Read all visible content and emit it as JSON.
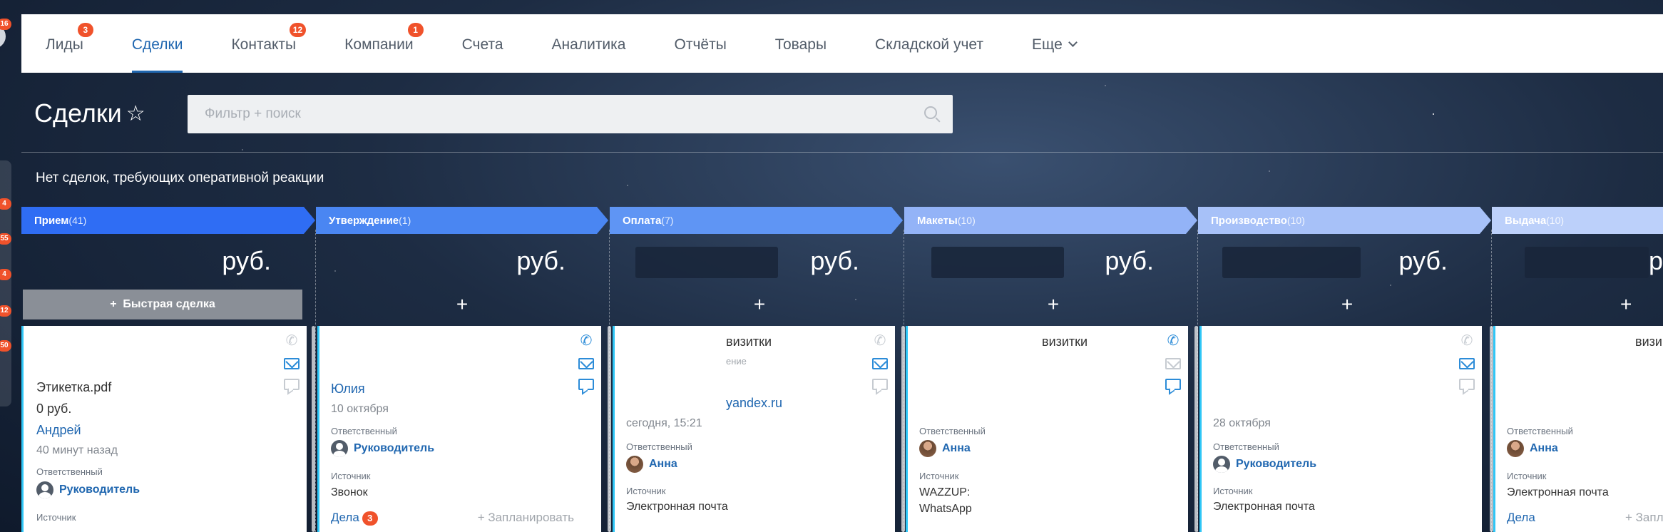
{
  "rail": {
    "badges": [
      "16",
      "4",
      "55",
      "4",
      "12",
      "50"
    ]
  },
  "nav": {
    "items": [
      {
        "label": "Лиды",
        "badge": "3"
      },
      {
        "label": "Сделки",
        "badge": ""
      },
      {
        "label": "Контакты",
        "badge": "12"
      },
      {
        "label": "Компании",
        "badge": "1"
      },
      {
        "label": "Счета",
        "badge": ""
      },
      {
        "label": "Аналитика",
        "badge": ""
      },
      {
        "label": "Отчёты",
        "badge": ""
      },
      {
        "label": "Товары",
        "badge": ""
      },
      {
        "label": "Складской учет",
        "badge": ""
      },
      {
        "label": "Еще",
        "badge": ""
      }
    ],
    "active": "Сделки"
  },
  "page": {
    "title": "Сделки",
    "search_placeholder": "Фильтр + поиск",
    "notice": "Нет сделок, требующих оперативной реакции"
  },
  "colors": {
    "accent": "#2067b0",
    "badge": "#f0522b"
  },
  "columns": [
    {
      "name": "Прием",
      "count": "(41)",
      "color": "#2f6df4",
      "sum": "руб.",
      "action": "Быстрая сделка",
      "card": {
        "title": "Этикетка.pdf",
        "amount": "0 руб.",
        "contact": "Андрей",
        "time": "40 минут назад",
        "resp_label": "Ответственный",
        "resp": "Руководитель",
        "source_label": "Источник"
      }
    },
    {
      "name": "Утверждение",
      "count": "(1)",
      "color": "#4a86f2",
      "sum": "руб.",
      "action": "+",
      "card": {
        "contact": "Юлия",
        "date": "10 октября",
        "resp_label": "Ответственный",
        "resp": "Руководитель",
        "source_label": "Источник",
        "source": "Звонок",
        "deals": "Дела",
        "deals_count": "3",
        "plan": "+ Запланировать"
      }
    },
    {
      "name": "Оплата",
      "count": "(7)",
      "color": "#5f95f4",
      "sum": "руб.",
      "action": "+",
      "card": {
        "title": "визитки",
        "sub": "ение",
        "email": "yandex.ru",
        "time": "сегодня, 15:21",
        "resp_label": "Ответственный",
        "resp": "Анна",
        "source_label": "Источник",
        "source": "Электронная почта"
      }
    },
    {
      "name": "Макеты",
      "count": "(10)",
      "color": "#93b3f7",
      "sum": "руб.",
      "action": "+",
      "card": {
        "title": "визитки",
        "resp_label": "Ответственный",
        "resp": "Анна",
        "source_label": "Источник",
        "source": "WAZZUP:",
        "source2": "WhatsApp"
      }
    },
    {
      "name": "Производство",
      "count": "(10)",
      "color": "#a7c1f8",
      "sum": "руб.",
      "action": "+",
      "card": {
        "date": "28 октября",
        "resp_label": "Ответственный",
        "resp": "Руководитель",
        "source_label": "Источник",
        "source": "Электронная почта"
      }
    },
    {
      "name": "Выдача",
      "count": "(10)",
      "color": "#bcd0fa",
      "sum": "р",
      "action": "+",
      "card": {
        "title": "визи",
        "resp_label": "Ответственный",
        "resp": "Анна",
        "source_label": "Источник",
        "source": "Электронная почта",
        "deals": "Дела",
        "plan": "+ Запла"
      }
    }
  ]
}
